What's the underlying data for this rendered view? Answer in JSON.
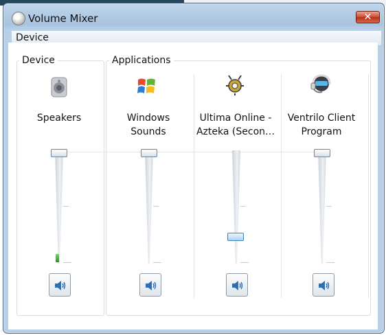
{
  "window": {
    "title": "Volume Mixer",
    "close_glyph": "✕"
  },
  "menu": {
    "items": [
      "Device"
    ]
  },
  "groups": {
    "device": "Device",
    "applications": "Applications"
  },
  "channels": [
    {
      "line1": "Speakers",
      "line2": "",
      "icon": "speaker-icon",
      "level": 1.0
    },
    {
      "line1": "Windows",
      "line2": "Sounds",
      "icon": "windows-flag-icon",
      "level": 1.0
    },
    {
      "line1": "Ultima Online -",
      "line2": "Azteka (Secon…",
      "icon": "ultima-online-icon",
      "level": 0.23
    },
    {
      "line1": "Ventrilo Client",
      "line2": "Program",
      "icon": "headset-icon",
      "level": 1.0
    }
  ],
  "colors": {
    "accent": "#3c7fb1",
    "peak_meter": "#1f9b1c",
    "close": "#c63a23"
  }
}
